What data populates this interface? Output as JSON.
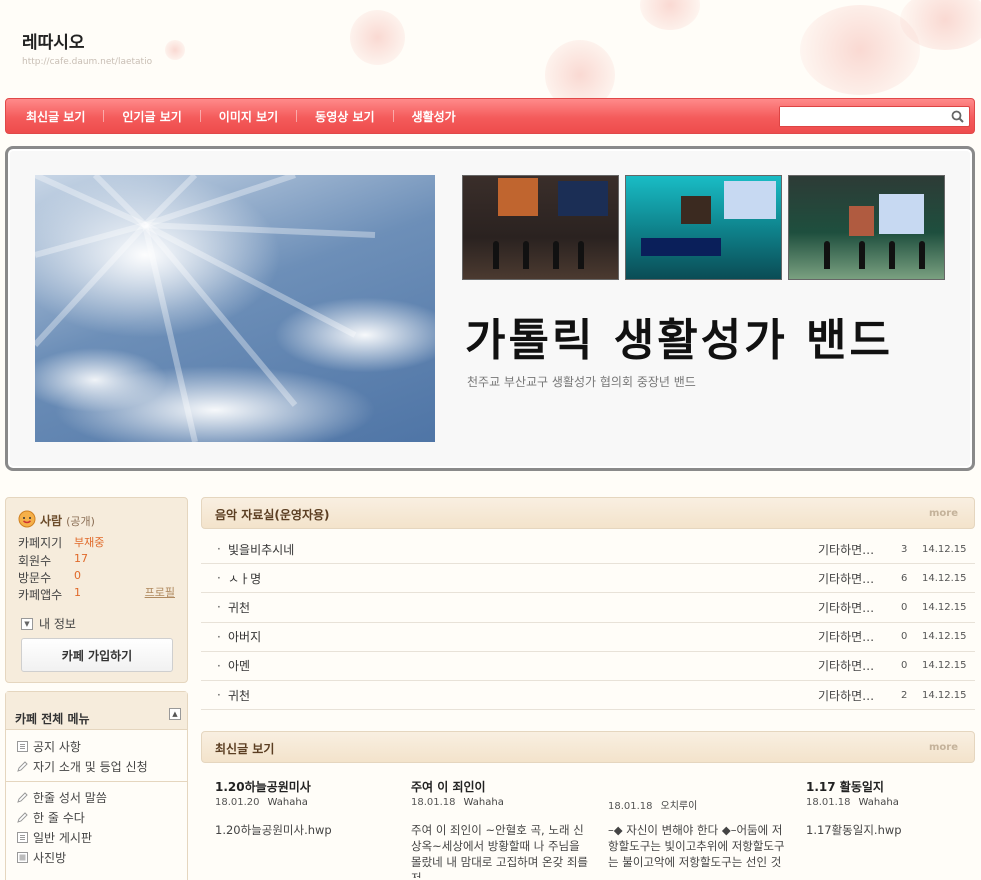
{
  "header": {
    "title": "레따시오",
    "url": "http://cafe.daum.net/laetatio"
  },
  "nav": {
    "items": [
      "최신글 보기",
      "인기글 보기",
      "이미지 보기",
      "동영상 보기",
      "생활성가"
    ],
    "search_placeholder": ""
  },
  "banner": {
    "title": "가톨릭 생활성가 밴드",
    "subtitle": "천주교 부산교구 생활성가 협의회 중장년 밴드"
  },
  "profile": {
    "name": "사람",
    "visibility": "(공개)",
    "stats": [
      {
        "label": "카페지기",
        "value": "부재중"
      },
      {
        "label": "회원수",
        "value": "17"
      },
      {
        "label": "방문수",
        "value": "0"
      },
      {
        "label": "카페앱수",
        "value": "1"
      }
    ],
    "profile_link": "프로필",
    "my_info": "내 정보",
    "join_button": "카페 가입하기"
  },
  "menu": {
    "title": "카페 전체 메뉴",
    "group1": [
      "공지 사항",
      "자기 소개 및 등업 신청"
    ],
    "group2": [
      "한줄 성서 말씀",
      "한 줄 수다",
      "일반 게시판",
      "사진방"
    ]
  },
  "music": {
    "title": "음악 자료실(운영자용)",
    "more": "more",
    "rows": [
      {
        "title": "빛을비추시네",
        "author": "기타하면…",
        "count": "3",
        "date": "14.12.15"
      },
      {
        "title": "ㅅㅏ명",
        "author": "기타하면…",
        "count": "6",
        "date": "14.12.15"
      },
      {
        "title": "귀천",
        "author": "기타하면…",
        "count": "0",
        "date": "14.12.15"
      },
      {
        "title": "아버지",
        "author": "기타하면…",
        "count": "0",
        "date": "14.12.15"
      },
      {
        "title": "아멘",
        "author": "기타하면…",
        "count": "0",
        "date": "14.12.15"
      },
      {
        "title": "귀천",
        "author": "기타하면…",
        "count": "2",
        "date": "14.12.15"
      }
    ]
  },
  "recent": {
    "title": "최신글 보기",
    "more": "more",
    "posts": [
      {
        "title": "1.20하늘공원미사",
        "date": "18.01.20",
        "author": "Wahaha",
        "body": "1.20하늘공원미사.hwp"
      },
      {
        "title": "주여 이 죄인이",
        "date": "18.01.18",
        "author": "Wahaha",
        "body": "주여 이 죄인이 ~안혈호 곡, 노래 신상옥~세상에서 방황할때 나 주님을 몰랐네 내 맘대로 고집하며 온갖 죄를 저"
      },
      {
        "title": "",
        "date": "18.01.18",
        "author": "오치루이",
        "body": "–◆ 자신이 변해야 한다 ◆–어둠에 저항할도구는 빛이고추위에 저항할도구는 불이고악에 저항할도구는 선인 것"
      },
      {
        "title": "1.17 활동일지",
        "date": "18.01.18",
        "author": "Wahaha",
        "body": "1.17활동일지.hwp"
      }
    ]
  }
}
